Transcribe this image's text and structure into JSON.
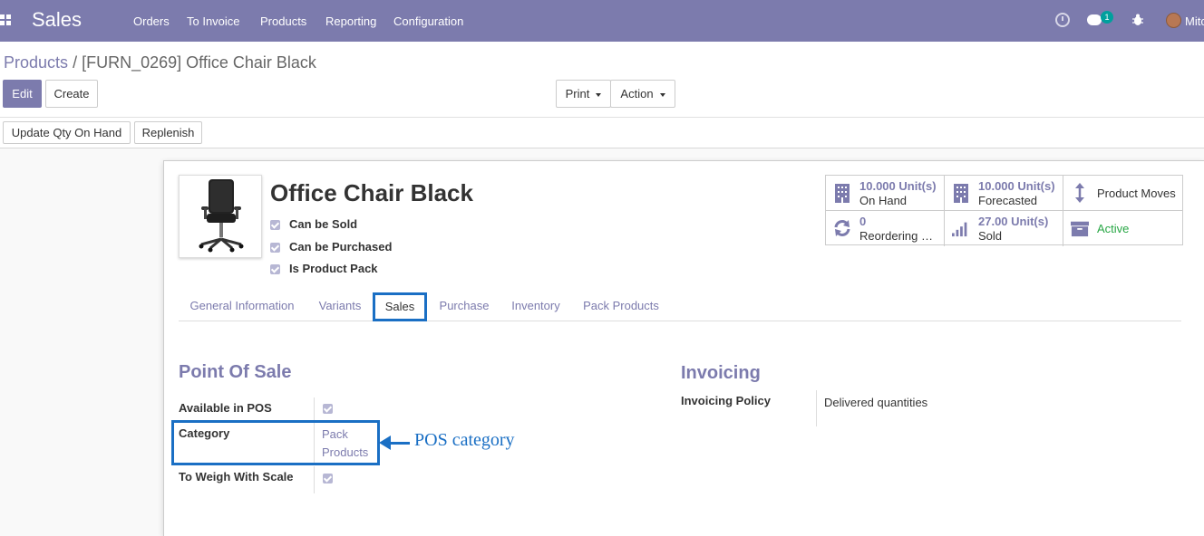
{
  "navbar": {
    "brand": "Sales",
    "menu": [
      "Orders",
      "To Invoice",
      "Products",
      "Reporting",
      "Configuration"
    ],
    "chat_badge": "1",
    "user_name": "Mitc",
    "icons": [
      "apps-icon",
      "clock-icon",
      "chat-icon",
      "bug-icon",
      "avatar"
    ]
  },
  "breadcrumb": {
    "parent": "Products",
    "separator": "/",
    "current": "[FURN_0269] Office Chair Black"
  },
  "buttons": {
    "edit": "Edit",
    "create": "Create",
    "print": "Print",
    "action": "Action",
    "update_qty": "Update Qty On Hand",
    "replenish": "Replenish"
  },
  "product": {
    "name": "Office Chair Black",
    "checks": [
      {
        "label": "Can be Sold",
        "checked": true
      },
      {
        "label": "Can be Purchased",
        "checked": true
      },
      {
        "label": "Is Product Pack",
        "checked": true
      }
    ]
  },
  "smart_buttons": {
    "on_hand": {
      "value": "10.000 Unit(s)",
      "label": "On Hand"
    },
    "forecasted": {
      "value": "10.000 Unit(s)",
      "label": "Forecasted"
    },
    "product_moves": {
      "label": "Product Moves"
    },
    "reordering": {
      "value": "0",
      "label": "Reordering Rules"
    },
    "sold": {
      "value": "27.00 Unit(s)",
      "label": "Sold"
    },
    "active": {
      "label": "Active",
      "color": "#28a745"
    }
  },
  "tabs": [
    "General Information",
    "Variants",
    "Sales",
    "Purchase",
    "Inventory",
    "Pack Products"
  ],
  "active_tab": "Sales",
  "point_of_sale": {
    "title": "Point Of Sale",
    "available_label": "Available in POS",
    "available_value": true,
    "category_label": "Category",
    "category_value_line1": "Pack",
    "category_value_line2": "Products",
    "weigh_label": "To Weigh With Scale",
    "weigh_value": true
  },
  "invoicing": {
    "title": "Invoicing",
    "policy_label": "Invoicing Policy",
    "policy_value": "Delivered quantities"
  },
  "annotation": {
    "text": "POS category",
    "color": "#1a6fc4"
  },
  "colors": {
    "brand": "#7c7bad",
    "highlight": "#1a6fc4"
  }
}
